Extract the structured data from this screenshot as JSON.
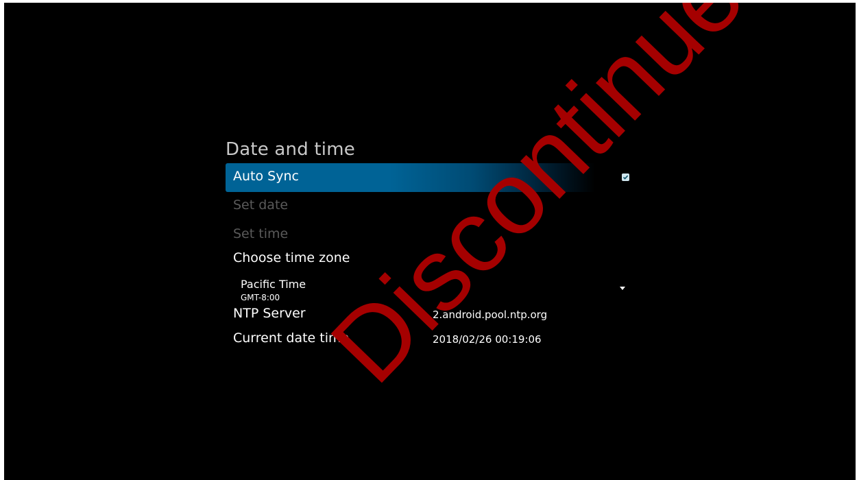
{
  "screen": {
    "title": "Date and time",
    "items": {
      "auto_sync": {
        "label": "Auto Sync",
        "checked": true
      },
      "set_date": {
        "label": "Set date",
        "enabled": false
      },
      "set_time": {
        "label": "Set time",
        "enabled": false
      },
      "time_zone": {
        "label": "Choose time zone",
        "selected_name": "Pacific Time",
        "selected_offset": "GMT-8:00"
      },
      "ntp_server": {
        "label": "NTP Server",
        "value": "2.android.pool.ntp.org"
      },
      "current_datetime": {
        "label": "Current date time",
        "value": "2018/02/26 00:19:06"
      }
    }
  },
  "watermark": {
    "text": "Discontinued",
    "color": "#a50000"
  },
  "colors": {
    "highlight": "#006396",
    "background": "#000000",
    "disabled_text": "#5a5a5a"
  }
}
